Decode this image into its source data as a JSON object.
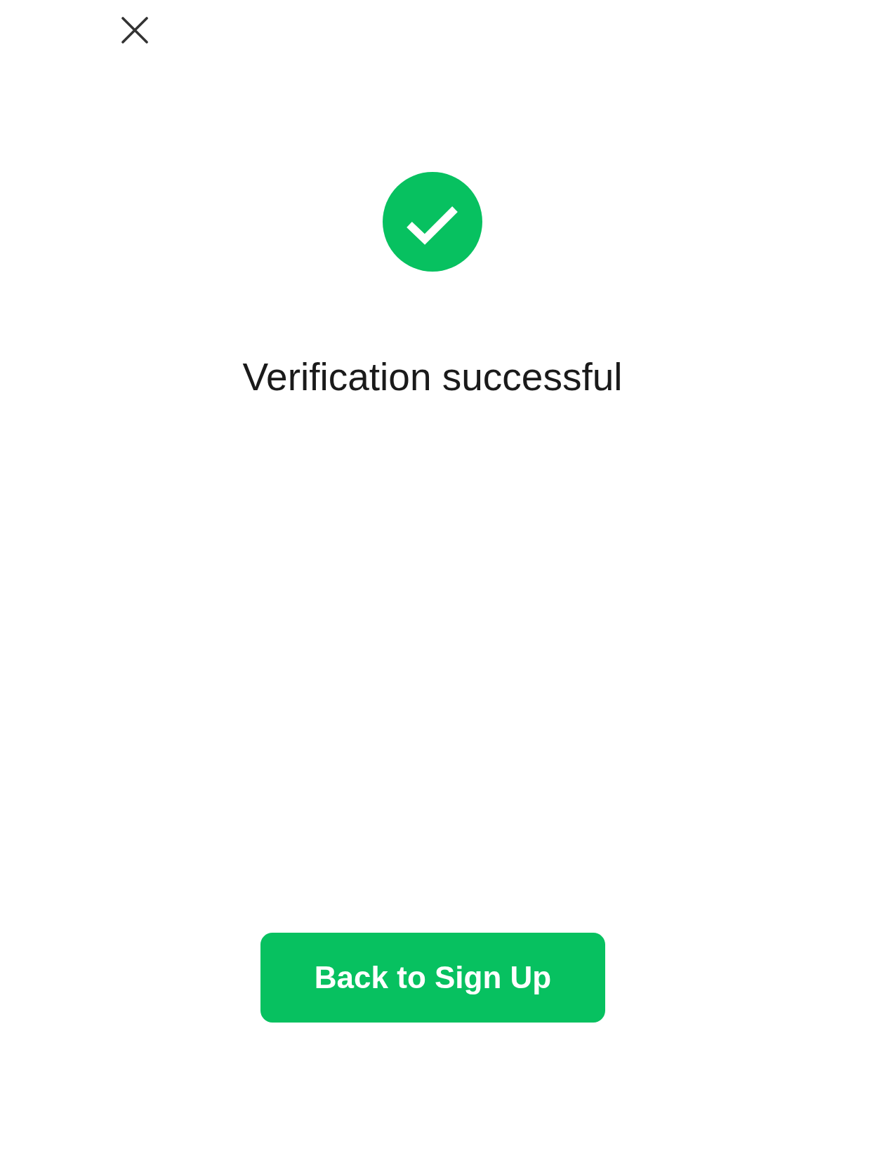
{
  "result": {
    "kind": "success",
    "title": "Verification successful"
  },
  "primary_button": {
    "label": "Back to Sign Up"
  }
}
